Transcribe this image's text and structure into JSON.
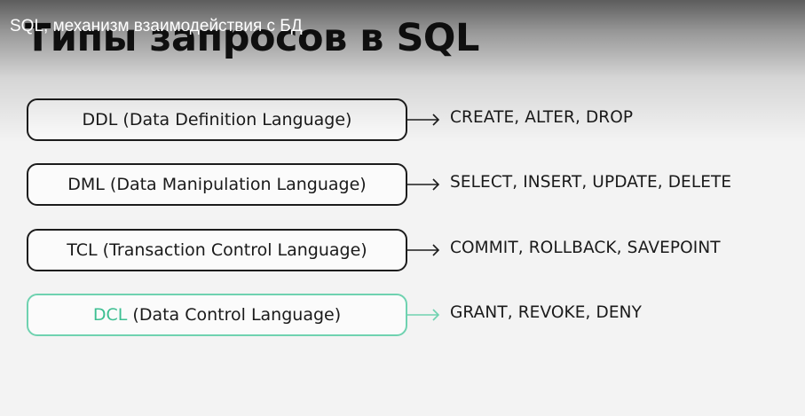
{
  "video": {
    "title": "SQL, механизм взаимодействия с БД"
  },
  "slide": {
    "title": "Типы запросов в SQL",
    "accent_color": "#3dbf92",
    "rows": [
      {
        "abbr": "DDL",
        "full": "(Data Definition Language)",
        "commands": "CREATE, ALTER, DROP",
        "highlighted": false
      },
      {
        "abbr": "DML",
        "full": "(Data Manipulation Language)",
        "commands": "SELECT, INSERT, UPDATE, DELETE",
        "highlighted": false
      },
      {
        "abbr": "TCL",
        "full": "(Transaction Control Language)",
        "commands": "COMMIT, ROLLBACK, SAVEPOINT",
        "highlighted": false
      },
      {
        "abbr": "DCL",
        "full": "(Data Control Language)",
        "commands": "GRANT, REVOKE, DENY",
        "highlighted": true
      }
    ]
  }
}
